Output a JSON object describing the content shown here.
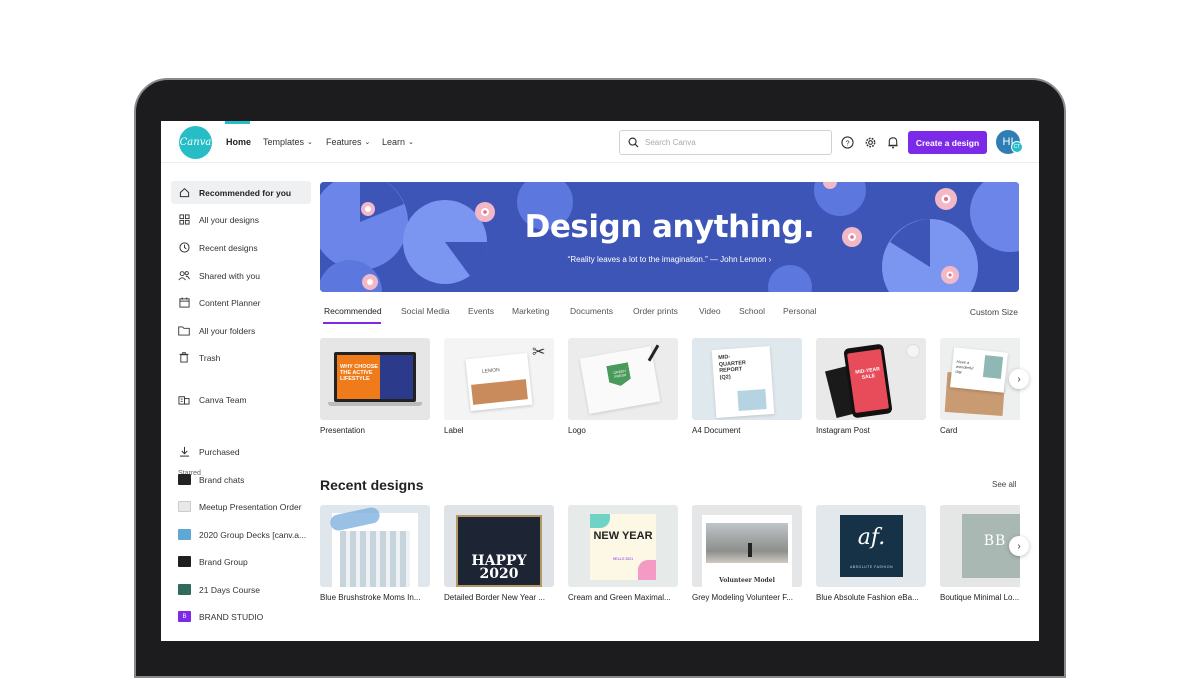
{
  "header": {
    "logo": "Canva",
    "nav": [
      {
        "label": "Home",
        "dropdown": false
      },
      {
        "label": "Templates",
        "dropdown": true
      },
      {
        "label": "Features",
        "dropdown": true
      },
      {
        "label": "Learn",
        "dropdown": true
      }
    ],
    "search_placeholder": "Search Canva",
    "create_label": "Create a design",
    "avatar_initials": "HI",
    "avatar_badge": "CT"
  },
  "sidebar": {
    "items": [
      {
        "label": "Recommended for you",
        "icon": "home-icon",
        "active": true
      },
      {
        "label": "All your designs",
        "icon": "grid-icon"
      },
      {
        "label": "Recent designs",
        "icon": "clock-icon"
      },
      {
        "label": "Shared with you",
        "icon": "people-icon"
      },
      {
        "label": "Content Planner",
        "icon": "calendar-icon"
      },
      {
        "label": "All your folders",
        "icon": "folder-icon"
      },
      {
        "label": "Trash",
        "icon": "trash-icon"
      }
    ],
    "team": {
      "label": "Canva Team",
      "icon": "building-icon"
    },
    "starred_heading": "Starred",
    "starred": [
      {
        "label": "Purchased",
        "icon": "download-icon"
      },
      {
        "label": "Brand chats",
        "thumb": "#222222"
      },
      {
        "label": "Meetup Presentation Order",
        "thumb": "#e8e8e8"
      },
      {
        "label": "2020 Group Decks [canv.a...",
        "thumb": "#5fa8d3"
      },
      {
        "label": "Brand Group",
        "thumb": "#1f1f1f"
      },
      {
        "label": "21 Days Course",
        "thumb": "#2e6b5a"
      },
      {
        "label": "BRAND STUDIO",
        "thumb": "#7d2ae8",
        "thumb_text": "B"
      }
    ]
  },
  "banner": {
    "title": "Design anything.",
    "quote": "“Reality leaves a lot to the imagination.” — John Lennon ›"
  },
  "tabs": [
    "Recommended",
    "Social Media",
    "Events",
    "Marketing",
    "Documents",
    "Order prints",
    "Video",
    "School",
    "Personal"
  ],
  "custom_size": "Custom Size",
  "templates": [
    {
      "label": "Presentation",
      "thumb_text": "WHY CHOOSE THE ACTIVE LIFESTYLE"
    },
    {
      "label": "Label",
      "thumb_text": "LEMON"
    },
    {
      "label": "Logo",
      "thumb_text": "GREEN FRESH"
    },
    {
      "label": "A4 Document",
      "thumb_text": "MID-QUARTER REPORT (Q2)"
    },
    {
      "label": "Instagram Post",
      "thumb_text": "MID-YEAR SALE"
    },
    {
      "label": "Card",
      "thumb_text": "Have a wonderful day"
    }
  ],
  "recent": {
    "heading": "Recent designs",
    "see_all": "See all",
    "items": [
      {
        "label": "Blue Brushstroke Moms In...",
        "thumb_text": ""
      },
      {
        "label": "Detailed Border New Year ...",
        "thumb_text": "HAPPY 2020"
      },
      {
        "label": "Cream and Green Maximal...",
        "thumb_text": "NEW YEAR",
        "thumb_sub": "HELLO 2021"
      },
      {
        "label": "Grey Modeling Volunteer F...",
        "thumb_text": "Volunteer Model"
      },
      {
        "label": "Blue Absolute Fashion eBa...",
        "thumb_text": "af.",
        "thumb_sub": "ABSOLUTE FASHION"
      },
      {
        "label": "Boutique Minimal Lo...",
        "thumb_text": "BB"
      }
    ]
  },
  "colors": {
    "accent": "#7d2ae8",
    "brand_teal": "#27bdc6",
    "banner_bg": "#3e55b8"
  }
}
